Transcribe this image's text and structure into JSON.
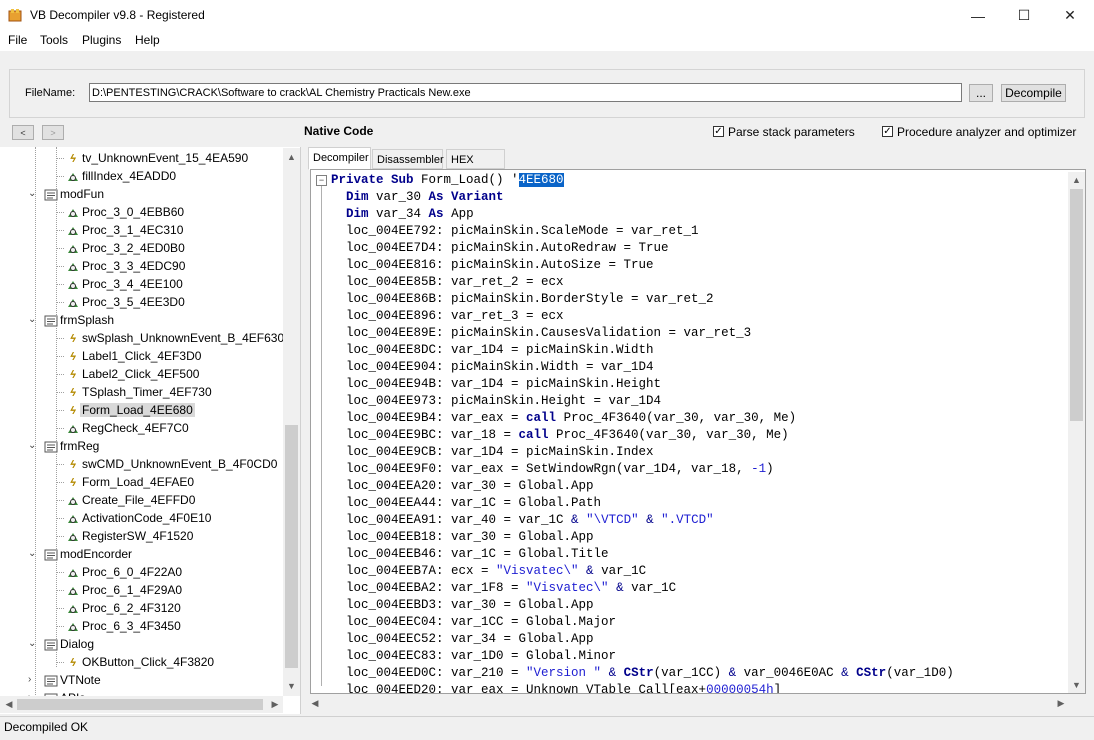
{
  "window": {
    "title": "VB Decompiler v9.8 - Registered",
    "minimize": "—",
    "maximize": "☐",
    "close": "✕"
  },
  "menu": [
    "File",
    "Tools",
    "Plugins",
    "Help"
  ],
  "file": {
    "label": "FileName:",
    "path": "D:\\PENTESTING\\CRACK\\Software to crack\\AL Chemistry Practicals New.exe",
    "browse_label": "...",
    "decompile_label": "Decompile"
  },
  "nav": {
    "back": "<",
    "forward": ">",
    "mode_label": "Native Code",
    "opt_stack": "Parse stack parameters",
    "opt_analyzer": "Procedure analyzer and optimizer"
  },
  "tree": {
    "rows": [
      {
        "label": "tv_UnknownEvent_15_4EA590",
        "kind": "event",
        "indent": 2
      },
      {
        "label": "fillIndex_4EADD0",
        "kind": "proc",
        "indent": 2
      },
      {
        "label": "modFun",
        "kind": "module",
        "indent": 1
      },
      {
        "label": "Proc_3_0_4EBB60",
        "kind": "proc",
        "indent": 2
      },
      {
        "label": "Proc_3_1_4EC310",
        "kind": "proc",
        "indent": 2
      },
      {
        "label": "Proc_3_2_4ED0B0",
        "kind": "proc",
        "indent": 2
      },
      {
        "label": "Proc_3_3_4EDC90",
        "kind": "proc",
        "indent": 2
      },
      {
        "label": "Proc_3_4_4EE100",
        "kind": "proc",
        "indent": 2
      },
      {
        "label": "Proc_3_5_4EE3D0",
        "kind": "proc",
        "indent": 2
      },
      {
        "label": "frmSplash",
        "kind": "module",
        "indent": 1
      },
      {
        "label": "swSplash_UnknownEvent_B_4EF630",
        "kind": "event",
        "indent": 2
      },
      {
        "label": "Label1_Click_4EF3D0",
        "kind": "event",
        "indent": 2
      },
      {
        "label": "Label2_Click_4EF500",
        "kind": "event",
        "indent": 2
      },
      {
        "label": "TSplash_Timer_4EF730",
        "kind": "event",
        "indent": 2
      },
      {
        "label": "Form_Load_4EE680",
        "kind": "event",
        "indent": 2,
        "selected": true
      },
      {
        "label": "RegCheck_4EF7C0",
        "kind": "proc",
        "indent": 2
      },
      {
        "label": "frmReg",
        "kind": "module",
        "indent": 1
      },
      {
        "label": "swCMD_UnknownEvent_B_4F0CD0",
        "kind": "event",
        "indent": 2
      },
      {
        "label": "Form_Load_4EFAE0",
        "kind": "event",
        "indent": 2
      },
      {
        "label": "Create_File_4EFFD0",
        "kind": "proc",
        "indent": 2
      },
      {
        "label": "ActivationCode_4F0E10",
        "kind": "proc",
        "indent": 2
      },
      {
        "label": "RegisterSW_4F1520",
        "kind": "proc",
        "indent": 2
      },
      {
        "label": "modEncorder",
        "kind": "module",
        "indent": 1
      },
      {
        "label": "Proc_6_0_4F22A0",
        "kind": "proc",
        "indent": 2
      },
      {
        "label": "Proc_6_1_4F29A0",
        "kind": "proc",
        "indent": 2
      },
      {
        "label": "Proc_6_2_4F3120",
        "kind": "proc",
        "indent": 2
      },
      {
        "label": "Proc_6_3_4F3450",
        "kind": "proc",
        "indent": 2
      },
      {
        "label": "Dialog",
        "kind": "module",
        "indent": 1
      },
      {
        "label": "OKButton_Click_4F3820",
        "kind": "event",
        "indent": 2
      },
      {
        "label": "VTNote",
        "kind": "module",
        "indent": 1,
        "collapsed": true
      },
      {
        "label": "APIs",
        "kind": "module",
        "indent": 1,
        "collapsed": true
      }
    ]
  },
  "tabs": [
    "Decompiler",
    "Disassembler",
    "HEX Editor"
  ],
  "code": {
    "lines": [
      [
        [
          "kw",
          "Private Sub "
        ],
        [
          "t",
          "Form_Load() "
        ],
        [
          "t",
          "'"
        ],
        [
          "hl",
          "4EE680"
        ]
      ],
      [
        [
          "t",
          "  "
        ],
        [
          "kw",
          "Dim "
        ],
        [
          "t",
          "var_30 "
        ],
        [
          "kw",
          "As Variant"
        ]
      ],
      [
        [
          "t",
          "  "
        ],
        [
          "kw",
          "Dim "
        ],
        [
          "t",
          "var_34 "
        ],
        [
          "kw",
          "As "
        ],
        [
          "t",
          "App"
        ]
      ],
      [
        [
          "t",
          "  loc_004EE792: picMainSkin.ScaleMode = var_ret_1"
        ]
      ],
      [
        [
          "t",
          "  loc_004EE7D4: picMainSkin.AutoRedraw = True"
        ]
      ],
      [
        [
          "t",
          "  loc_004EE816: picMainSkin.AutoSize = True"
        ]
      ],
      [
        [
          "t",
          "  loc_004EE85B: var_ret_2 = ecx"
        ]
      ],
      [
        [
          "t",
          "  loc_004EE86B: picMainSkin.BorderStyle = var_ret_2"
        ]
      ],
      [
        [
          "t",
          "  loc_004EE896: var_ret_3 = ecx"
        ]
      ],
      [
        [
          "t",
          "  loc_004EE89E: picMainSkin.CausesValidation = var_ret_3"
        ]
      ],
      [
        [
          "t",
          "  loc_004EE8DC: var_1D4 = picMainSkin.Width"
        ]
      ],
      [
        [
          "t",
          "  loc_004EE904: picMainSkin.Width = var_1D4"
        ]
      ],
      [
        [
          "t",
          "  loc_004EE94B: var_1D4 = picMainSkin.Height"
        ]
      ],
      [
        [
          "t",
          "  loc_004EE973: picMainSkin.Height = var_1D4"
        ]
      ],
      [
        [
          "t",
          "  loc_004EE9B4: var_eax = "
        ],
        [
          "kw",
          "call "
        ],
        [
          "t",
          "Proc_4F3640(var_30, var_30, Me)"
        ]
      ],
      [
        [
          "t",
          "  loc_004EE9BC: var_18 = "
        ],
        [
          "kw",
          "call "
        ],
        [
          "t",
          "Proc_4F3640(var_30, var_30, Me)"
        ]
      ],
      [
        [
          "t",
          "  loc_004EE9CB: var_1D4 = picMainSkin.Index"
        ]
      ],
      [
        [
          "t",
          "  loc_004EE9F0: var_eax = SetWindowRgn(var_1D4, var_18, "
        ],
        [
          "num",
          "-1"
        ],
        [
          "t",
          ")"
        ]
      ],
      [
        [
          "t",
          "  loc_004EEA20: var_30 = Global.App"
        ]
      ],
      [
        [
          "t",
          "  loc_004EEA44: var_1C = Global.Path"
        ]
      ],
      [
        [
          "t",
          "  loc_004EEA91: var_40 = var_1C "
        ],
        [
          "kwn",
          "& "
        ],
        [
          "str",
          "\"\\VTCD\""
        ],
        [
          "kwn",
          " & "
        ],
        [
          "str",
          "\".VTCD\""
        ]
      ],
      [
        [
          "t",
          "  loc_004EEB18: var_30 = Global.App"
        ]
      ],
      [
        [
          "t",
          "  loc_004EEB46: var_1C = Global.Title"
        ]
      ],
      [
        [
          "t",
          "  loc_004EEB7A: ecx = "
        ],
        [
          "str",
          "\"Visvatec\\\""
        ],
        [
          "kwn",
          " & "
        ],
        [
          "t",
          "var_1C"
        ]
      ],
      [
        [
          "t",
          "  loc_004EEBA2: var_1F8 = "
        ],
        [
          "str",
          "\"Visvatec\\\""
        ],
        [
          "kwn",
          " & "
        ],
        [
          "t",
          "var_1C"
        ]
      ],
      [
        [
          "t",
          "  loc_004EEBD3: var_30 = Global.App"
        ]
      ],
      [
        [
          "t",
          "  loc_004EEC04: var_1CC = Global.Major"
        ]
      ],
      [
        [
          "t",
          "  loc_004EEC52: var_34 = Global.App"
        ]
      ],
      [
        [
          "t",
          "  loc_004EEC83: var_1D0 = Global.Minor"
        ]
      ],
      [
        [
          "t",
          "  loc_004EED0C: var_210 = "
        ],
        [
          "str",
          "\"Version \""
        ],
        [
          "kwn",
          " & "
        ],
        [
          "kw",
          "CStr"
        ],
        [
          "t",
          "(var_1CC) "
        ],
        [
          "kwn",
          "& "
        ],
        [
          "t",
          "var_0046E0AC "
        ],
        [
          "kwn",
          "& "
        ],
        [
          "kw",
          "CStr"
        ],
        [
          "t",
          "(var_1D0)"
        ]
      ],
      [
        [
          "t",
          "  loc_004EED20: var_eax = Unknown_VTable_Call[eax+"
        ],
        [
          "num",
          "00000054h"
        ],
        [
          "t",
          "]"
        ]
      ]
    ]
  },
  "status": {
    "text": "Decompiled OK"
  },
  "colors": {
    "selection": "#0a64c8",
    "keyword": "#00008b",
    "string": "#1e1ed2"
  }
}
